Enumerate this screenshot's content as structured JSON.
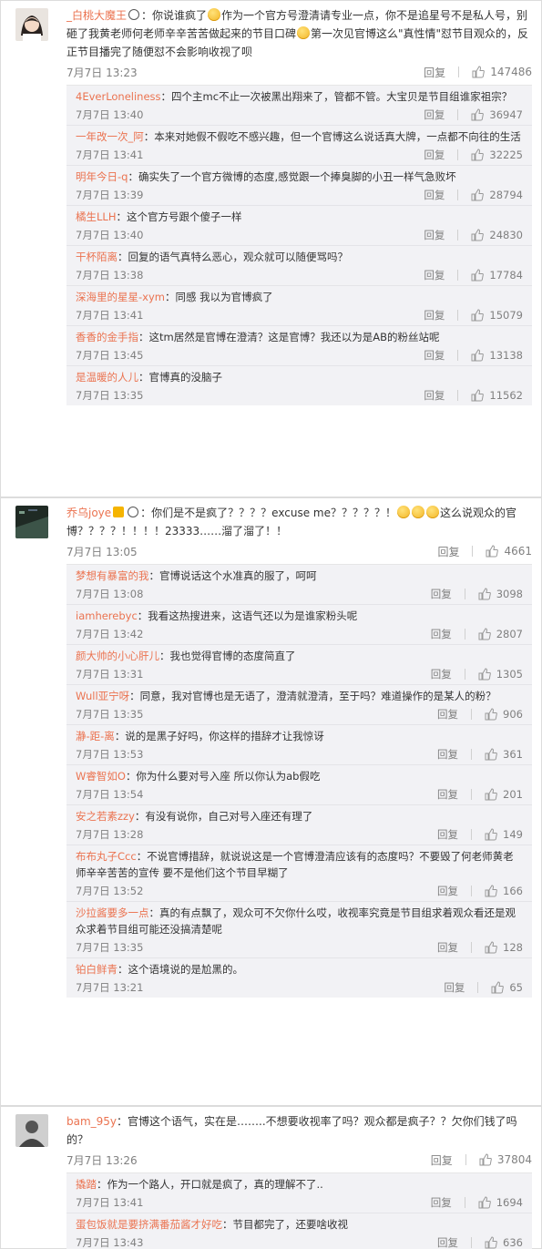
{
  "labels": {
    "reply": "回复"
  },
  "colors": {
    "username": "#eb7350",
    "reply_bg": "#f2f2f5"
  },
  "threads": [
    {
      "avatar_icon": "girl-avatar-icon",
      "comment": {
        "user": "_白桃大魔王",
        "text_parts": [
          "：你说谁疯了",
          "作为一个官方号澄清请专业一点，你不是追星号不是私人号，别砸了我黄老师何老师辛辛苦苦做起来的节目口碑",
          "第一次见官博这么\"真性情\"怼节目观众的，反正节目播完了随便怼不会影响收视了呗"
        ],
        "time": "7月7日 13:23",
        "likes": "147486"
      },
      "replies": [
        {
          "user": "4EverLoneliness",
          "text": "：四个主mc不止一次被黑出翔来了，管都不管。大宝贝是节目组谁家祖宗？",
          "time": "7月7日 13:40",
          "likes": "36947"
        },
        {
          "user": "一年改一次_阿",
          "text": "：本来对她假不假吃不感兴趣，但一个官博这么说话真大牌，一点都不向往的生活",
          "time": "7月7日 13:41",
          "likes": "32225"
        },
        {
          "user": "明年今日-q",
          "text": "：确实失了一个官方微博的态度,感觉跟一个捧臭脚的小丑一样气急败坏",
          "time": "7月7日 13:39",
          "likes": "28794"
        },
        {
          "user": "橘生LLH",
          "text": "：这个官方号跟个傻子一样",
          "time": "7月7日 13:40",
          "likes": "24830"
        },
        {
          "user": "干杯陌离",
          "text": "：回复的语气真特么恶心，观众就可以随便骂吗？",
          "time": "7月7日 13:38",
          "likes": "17784"
        },
        {
          "user": "深海里的星星-xym",
          "text": "：同感  我以为官博疯了",
          "time": "7月7日 13:41",
          "likes": "15079"
        },
        {
          "user": "香香的金手指",
          "text": "：这tm居然是官博在澄清？这是官博？我还以为是AB的粉丝站呢",
          "time": "7月7日 13:45",
          "likes": "13138"
        },
        {
          "user": "是温暖的人儿",
          "text": "：官博真的没脑子",
          "time": "7月7日 13:35",
          "likes": "11562"
        }
      ]
    },
    {
      "avatar_icon": "dark-avatar-icon",
      "comment": {
        "user": "乔乌joye",
        "text_parts": [
          "：你们是不是疯了？？？？excuse me？？？？？！",
          "这么说观众的官博？？？？！！！！23333……溜了溜了！！"
        ],
        "time": "7月7日 13:05",
        "likes": "4661"
      },
      "replies": [
        {
          "user": "梦想有暴富的我",
          "text": "：官博说话这个水准真的服了，呵呵",
          "time": "7月7日 13:08",
          "likes": "3098"
        },
        {
          "user": "iamherebyc",
          "text": "：我看这热搜进来，这语气还以为是谁家粉头呢",
          "time": "7月7日 13:42",
          "likes": "2807"
        },
        {
          "user": "颜大帅的小心肝儿",
          "text": "：我也觉得官博的态度简直了",
          "time": "7月7日 13:31",
          "likes": "1305"
        },
        {
          "user": "Wull亚宁呀",
          "text": "：同意，我对官博也是无语了，澄清就澄清，至于吗？难道操作的是某人的粉？",
          "time": "7月7日 13:35",
          "likes": "906"
        },
        {
          "user": "瀞-距-离",
          "text": "：说的是黑子好吗，你这样的措辞才让我惊讶",
          "time": "7月7日 13:53",
          "likes": "361"
        },
        {
          "user": "W睿智如O",
          "text": "：你为什么要对号入座 所以你认为ab假吃",
          "time": "7月7日 13:54",
          "likes": "201"
        },
        {
          "user": "安之若素zzy",
          "text": "：有没有说你，自己对号入座还有理了",
          "time": "7月7日 13:28",
          "likes": "149"
        },
        {
          "user": "布布丸子Ccc",
          "text": "：不说官博措辞，就说说这是一个官博澄清应该有的态度吗？不要毁了何老师黄老师辛辛苦苦的宣传 要不是他们这个节目早糊了",
          "time": "7月7日 13:52",
          "likes": "166"
        },
        {
          "user": "沙拉酱要多一点",
          "text": "：真的有点飘了，观众可不欠你什么哎，收视率究竟是节目组求着观众看还是观众求着节目组可能还没搞清楚呢",
          "time": "7月7日 13:35",
          "likes": "128"
        },
        {
          "user": "铂白鲜青",
          "text": "：这个语境说的是尬黑的。",
          "time": "7月7日 13:21",
          "likes": "65"
        }
      ]
    },
    {
      "avatar_icon": "person-avatar-icon",
      "comment": {
        "user": "bam_95y",
        "text_parts": [
          "：官博这个语气，实在是……..不想要收视率了吗？观众都是疯子？？欠你们钱了吗的？"
        ],
        "time": "7月7日 13:26",
        "likes": "37804"
      },
      "replies": [
        {
          "user": "撬踏",
          "text": "：作为一个路人，开口就是疯了，真的理解不了..",
          "time": "7月7日 13:41",
          "likes": "1694"
        },
        {
          "user": "蛋包饭就是要挤满番茄酱才好吃",
          "text": "：节目都完了，还要啥收视",
          "time": "7月7日 13:43",
          "likes": "636"
        }
      ]
    }
  ]
}
